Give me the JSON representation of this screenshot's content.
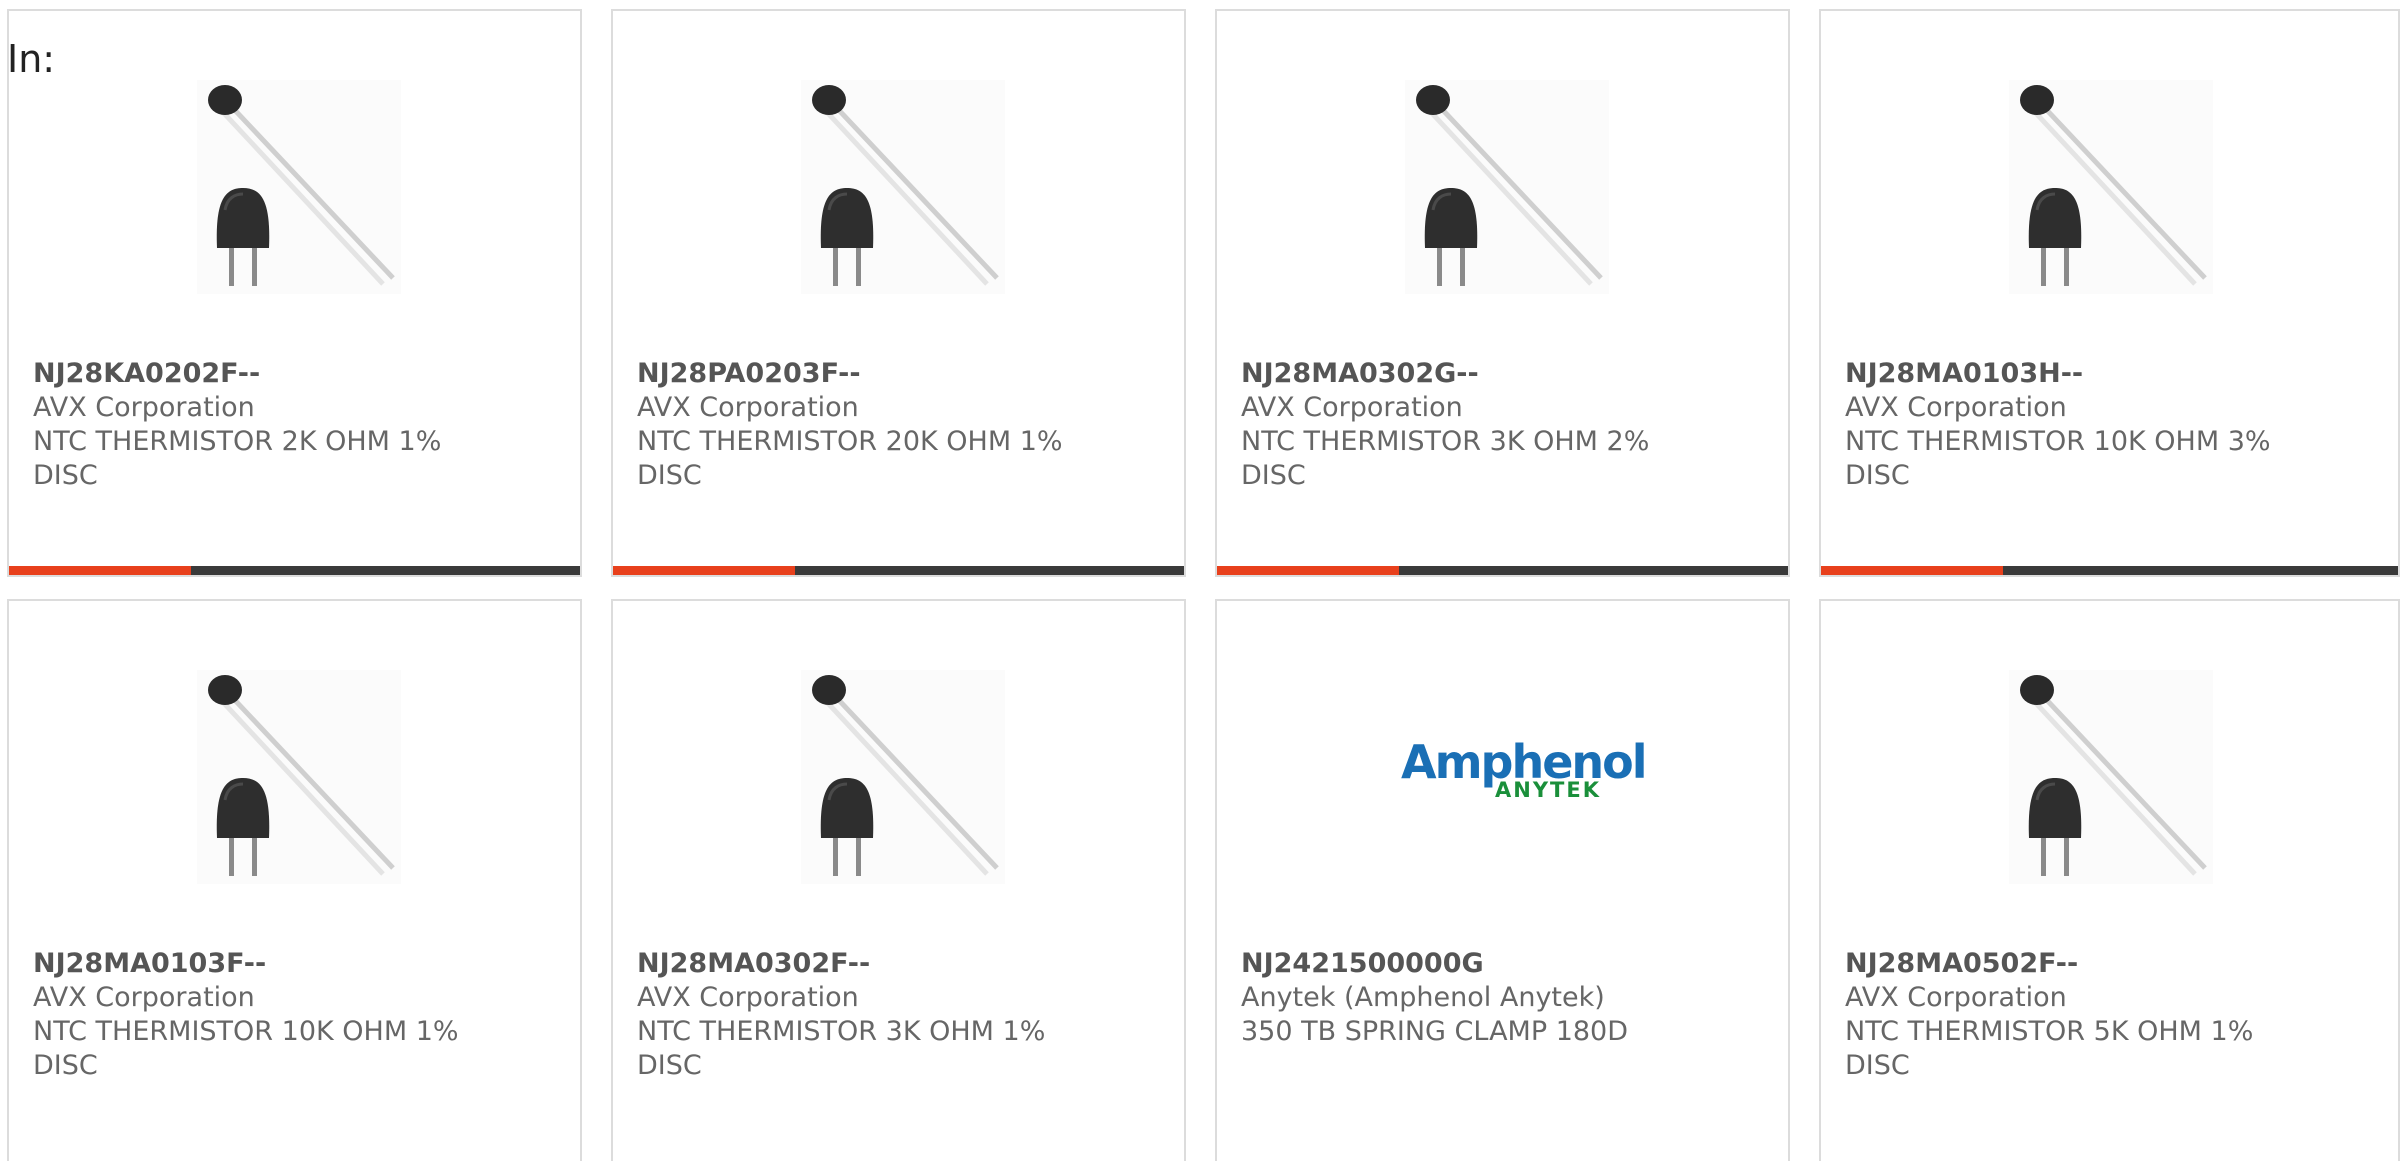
{
  "filter": {
    "label": "In:"
  },
  "colors": {
    "accent": "#e8401c",
    "bar": "#3a3a3a",
    "border": "#dcdcdc",
    "logo_blue": "#1a6fb5",
    "logo_green": "#1a8f3a"
  },
  "products": [
    {
      "part_number": "NJ28KA0202F--",
      "manufacturer": "AVX Corporation",
      "description": "NTC THERMISTOR 2K OHM 1%",
      "description2": "DISC",
      "image": "thermistor-disc-image"
    },
    {
      "part_number": "NJ28PA0203F--",
      "manufacturer": "AVX Corporation",
      "description": "NTC THERMISTOR 20K OHM 1%",
      "description2": "DISC",
      "image": "thermistor-disc-image"
    },
    {
      "part_number": "NJ28MA0302G--",
      "manufacturer": "AVX Corporation",
      "description": "NTC THERMISTOR 3K OHM 2%",
      "description2": "DISC",
      "image": "thermistor-disc-image"
    },
    {
      "part_number": "NJ28MA0103H--",
      "manufacturer": "AVX Corporation",
      "description": "NTC THERMISTOR 10K OHM 3%",
      "description2": "DISC",
      "image": "thermistor-disc-image"
    },
    {
      "part_number": "NJ28MA0103F--",
      "manufacturer": "AVX Corporation",
      "description": "NTC THERMISTOR 10K OHM 1%",
      "description2": "DISC",
      "image": "thermistor-disc-image"
    },
    {
      "part_number": "NJ28MA0302F--",
      "manufacturer": "AVX Corporation",
      "description": "NTC THERMISTOR 3K OHM 1%",
      "description2": "DISC",
      "image": "thermistor-disc-image"
    },
    {
      "part_number": "NJ2421500000G",
      "manufacturer": "Anytek (Amphenol Anytek)",
      "description": "350 TB SPRING CLAMP 180D",
      "description2": "",
      "image": "amphenol-anytek-logo",
      "logo_line1": "Amphenol",
      "logo_line2": "ANYTEK"
    },
    {
      "part_number": "NJ28MA0502F--",
      "manufacturer": "AVX Corporation",
      "description": "NTC THERMISTOR 5K OHM 1%",
      "description2": "DISC",
      "image": "thermistor-disc-image"
    }
  ]
}
